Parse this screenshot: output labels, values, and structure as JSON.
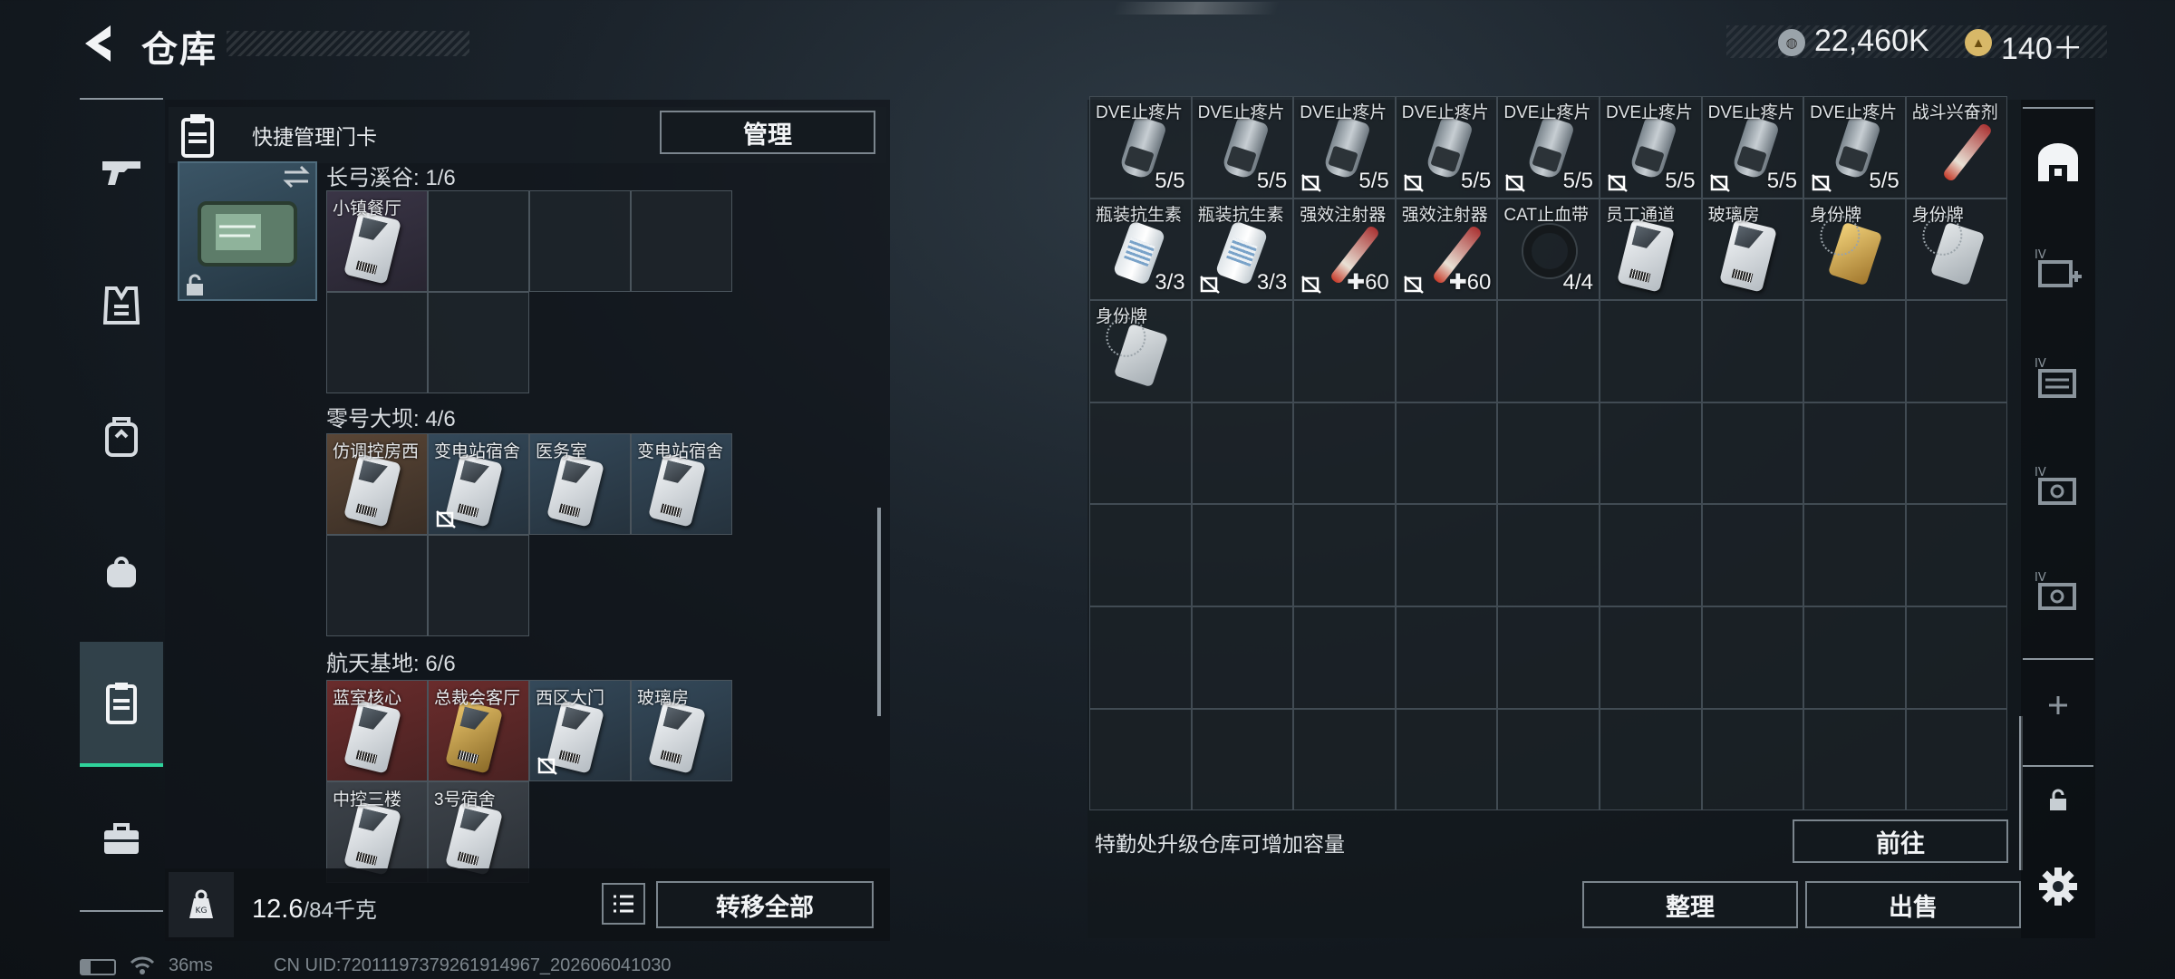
{
  "header": {
    "title": "仓库",
    "currency1": "22,460K",
    "currency2": "140＋"
  },
  "left_panel": {
    "title": "快捷管理门卡",
    "manage_button": "管理",
    "sections": [
      {
        "label": "长弓溪谷: 1/6",
        "cards": [
          {
            "name": "小镇餐厅",
            "bg": "purple",
            "nodrop": false
          },
          null,
          null,
          null,
          {
            "empty": true
          },
          {
            "empty": true
          }
        ]
      },
      {
        "label": "零号大坝: 4/6",
        "cards": [
          {
            "name": "仿调控房西",
            "bg": "brown",
            "nodrop": false
          },
          {
            "name": "变电站宿舍",
            "bg": "blue",
            "nodrop": true
          },
          {
            "name": "医务室",
            "bg": "blue",
            "nodrop": false
          },
          {
            "name": "变电站宿舍",
            "bg": "blue",
            "nodrop": false
          },
          {
            "empty": true
          },
          {
            "empty": true
          }
        ]
      },
      {
        "label": "航天基地: 6/6",
        "cards": [
          {
            "name": "蓝室核心",
            "bg": "red",
            "nodrop": false
          },
          {
            "name": "总裁会客厅",
            "bg": "red",
            "gold": true,
            "nodrop": false
          },
          {
            "name": "西区大门",
            "bg": "blue",
            "nodrop": true
          },
          {
            "name": "玻璃房",
            "bg": "blue",
            "nodrop": false
          },
          {
            "name": "中控三楼",
            "bg": "gray",
            "nodrop": false
          },
          {
            "name": "3号宿舍",
            "bg": "gray",
            "nodrop": false
          }
        ]
      }
    ],
    "weight_current": "12.6",
    "weight_max": "/84千克",
    "transfer_all": "转移全部"
  },
  "right_panel": {
    "rows": [
      [
        {
          "name": "DVE止疼片",
          "type": "pill",
          "count": "5/5",
          "bg": "gray"
        },
        {
          "name": "DVE止疼片",
          "type": "pill",
          "count": "5/5",
          "bg": "gray"
        },
        {
          "name": "DVE止疼片",
          "type": "pill",
          "count": "5/5",
          "nodrop": true,
          "bg": "gray"
        },
        {
          "name": "DVE止疼片",
          "type": "pill",
          "count": "5/5",
          "nodrop": true,
          "bg": "gray"
        },
        {
          "name": "DVE止疼片",
          "type": "pill",
          "count": "5/5",
          "nodrop": true,
          "bg": "gray"
        },
        {
          "name": "DVE止疼片",
          "type": "pill",
          "count": "5/5",
          "nodrop": true,
          "bg": "gray"
        },
        {
          "name": "DVE止疼片",
          "type": "pill",
          "count": "5/5",
          "nodrop": true,
          "bg": "gray"
        },
        {
          "name": "DVE止疼片",
          "type": "pill",
          "count": "5/5",
          "nodrop": true,
          "bg": "gray"
        },
        {
          "name": "战斗兴奋剂",
          "type": "syringe",
          "count": "",
          "bg": "blue"
        }
      ],
      [
        {
          "name": "瓶装抗生素",
          "type": "bottle",
          "count": "3/3",
          "bg": "green"
        },
        {
          "name": "瓶装抗生素",
          "type": "bottle",
          "count": "3/3",
          "nodrop": true,
          "bg": "gray"
        },
        {
          "name": "强效注射器",
          "type": "syringe",
          "count": "✚60",
          "nodrop": true,
          "bg": "green"
        },
        {
          "name": "强效注射器",
          "type": "syringe",
          "count": "✚60",
          "nodrop": true,
          "bg": "green"
        },
        {
          "name": "CAT止血带",
          "type": "tourniquet",
          "count": "4/4",
          "bg": "gray"
        },
        {
          "name": "员工通道",
          "type": "card",
          "count": "",
          "bg": "purple"
        },
        {
          "name": "玻璃房",
          "type": "card",
          "count": "",
          "bg": "blue"
        },
        {
          "name": "身份牌",
          "type": "tag-gold",
          "count": "",
          "bg": "blue"
        },
        {
          "name": "身份牌",
          "type": "tag",
          "count": "",
          "bg": "blue"
        }
      ],
      [
        {
          "name": "身份牌",
          "type": "tag",
          "count": "",
          "bg": "blue"
        }
      ]
    ],
    "upgrade_hint": "特勤处升级仓库可增加容量",
    "goto_button": "前往",
    "sort_button": "整理",
    "sell_button": "出售"
  },
  "status_bar": {
    "ping": "36ms",
    "uid": "CN UID:72011197379261914967_202606041030"
  },
  "colors": {
    "accent": "#2fd39b",
    "border": "#7b858d"
  }
}
